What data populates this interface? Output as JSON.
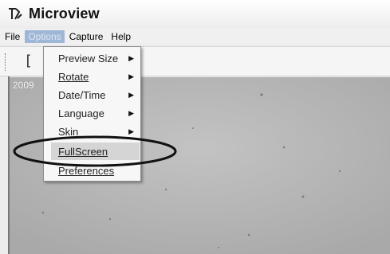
{
  "window": {
    "title": "Microview"
  },
  "menubar": {
    "items": [
      {
        "label": "File"
      },
      {
        "label": "Options"
      },
      {
        "label": "Capture"
      },
      {
        "label": "Help"
      }
    ]
  },
  "preview": {
    "overlay_text": "2009"
  },
  "options_menu": {
    "items": [
      {
        "label": "Preview Size"
      },
      {
        "label": "Rotate"
      },
      {
        "label": "Date/Time"
      },
      {
        "label": "Language"
      },
      {
        "label": "Skin"
      },
      {
        "label": "FullScreen"
      },
      {
        "label": "Preferences"
      }
    ]
  },
  "colors": {
    "menu_highlight": "#9fb7d6",
    "preview_bg": "#b9b9b9",
    "callout_ring": "#111111"
  },
  "icons": {
    "app": "microview-app-icon",
    "submenu": "submenu-arrow-icon"
  }
}
